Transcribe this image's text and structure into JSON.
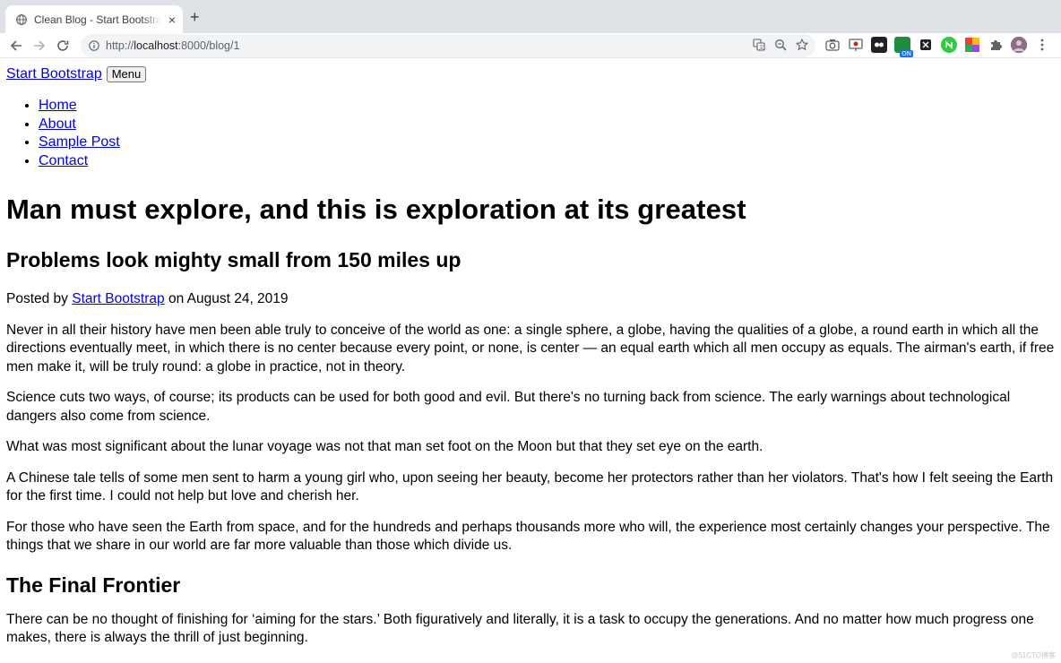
{
  "browser": {
    "tab_title": "Clean Blog - Start Bootstrap Theme",
    "url_prefix": "http://",
    "url_host": "localhost",
    "url_rest": ":8000/blog/1",
    "close_glyph": "×",
    "newtab_glyph": "+",
    "extensions": [
      {
        "icon": "camera-icon",
        "color": "#5f6368"
      },
      {
        "icon": "screen-share-icon",
        "color": "#c62828"
      },
      {
        "icon": "ghost-icon",
        "color": "#202124"
      },
      {
        "icon": "on-badge-icon",
        "color": "#1e8e3e",
        "text": "ON"
      },
      {
        "icon": "x-icon",
        "color": "#202124"
      },
      {
        "icon": "green-circle-icon",
        "color": "#2ecc40"
      },
      {
        "icon": "color-grid-icon",
        "color": "#f4b400"
      },
      {
        "icon": "puzzle-icon",
        "color": "#5f6368"
      },
      {
        "icon": "avatar-icon",
        "color": "#8e6c88"
      }
    ]
  },
  "site": {
    "brand": "Start Bootstrap",
    "menu_button": "Menu",
    "nav": [
      "Home",
      "About",
      "Sample Post",
      "Contact"
    ]
  },
  "post": {
    "title": "Man must explore, and this is exploration at its greatest",
    "subtitle": "Problems look mighty small from 150 miles up",
    "meta_prefix": "Posted by ",
    "meta_author": "Start Bootstrap",
    "meta_suffix": " on August 24, 2019",
    "paragraphs": [
      "Never in all their history have men been able truly to conceive of the world as one: a single sphere, a globe, having the qualities of a globe, a round earth in which all the directions eventually meet, in which there is no center because every point, or none, is center — an equal earth which all men occupy as equals. The airman's earth, if free men make it, will be truly round: a globe in practice, not in theory.",
      "Science cuts two ways, of course; its products can be used for both good and evil. But there's no turning back from science. The early warnings about technological dangers also come from science.",
      "What was most significant about the lunar voyage was not that man set foot on the Moon but that they set eye on the earth.",
      "A Chinese tale tells of some men sent to harm a young girl who, upon seeing her beauty, become her protectors rather than her violators. That's how I felt seeing the Earth for the first time. I could not help but love and cherish her.",
      "For those who have seen the Earth from space, and for the hundreds and perhaps thousands more who will, the experience most certainly changes your perspective. The things that we share in our world are far more valuable than those which divide us."
    ],
    "section_heading": "The Final Frontier",
    "section_paragraph": "There can be no thought of finishing for ‘aiming for the stars.’ Both figuratively and literally, it is a task to occupy the generations. And no matter how much progress one makes, there is always the thrill of just beginning."
  },
  "watermark": "@51CTO博客"
}
